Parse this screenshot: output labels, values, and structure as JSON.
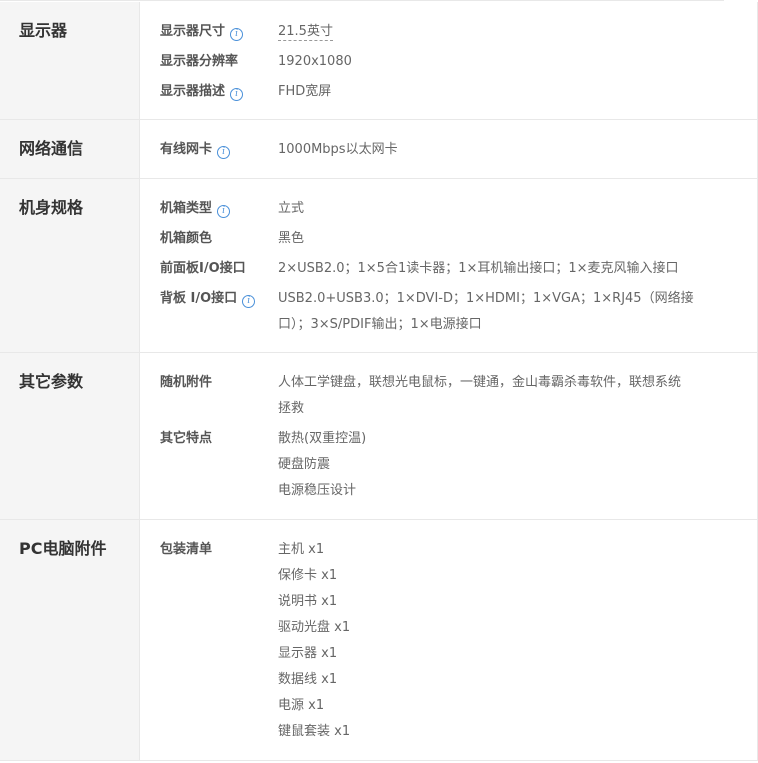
{
  "sections": {
    "display": {
      "title": "显示器",
      "size_label": "显示器尺寸",
      "size_value": "21.5英寸",
      "resolution_label": "显示器分辨率",
      "resolution_value": "1920x1080",
      "desc_label": "显示器描述",
      "desc_value": "FHD宽屏"
    },
    "network": {
      "title": "网络通信",
      "nic_label": "有线网卡",
      "nic_value": "1000Mbps以太网卡"
    },
    "chassis": {
      "title": "机身规格",
      "type_label": "机箱类型",
      "type_value": "立式",
      "color_label": "机箱颜色",
      "color_value": "黑色",
      "front_io_label": "前面板I/O接口",
      "front_io_value": "2×USB2.0；1×5合1读卡器；1×耳机输出接口；1×麦克风输入接口",
      "rear_io_label": "背板 I/O接口",
      "rear_io_line1": "USB2.0+USB3.0；1×DVI-D；1×HDMI；1×VGA；1×RJ45（网络接",
      "rear_io_line2": "口）；3×S/PDIF输出；1×电源接口"
    },
    "other": {
      "title": "其它参数",
      "accessories_label": "随机附件",
      "accessories_line1": "人体工学键盘，联想光电鼠标，一键通，金山毒霸杀毒软件，联想系统",
      "accessories_line2": "拯救",
      "features_label": "其它特点",
      "features": [
        "散热(双重控温)",
        "硬盘防震",
        "电源稳压设计"
      ]
    },
    "pc_accessories": {
      "title": "PC电脑附件",
      "package_label": "包装清单",
      "package_items": [
        "主机 x1",
        "保修卡 x1",
        "说明书 x1",
        "驱动光盘 x1",
        "显示器 x1",
        "数据线 x1",
        "电源 x1",
        "键鼠套装 x1"
      ]
    }
  },
  "icons": {
    "info": "info-circle-icon",
    "info_glyph": "i",
    "info_color": "#4a90d9"
  }
}
